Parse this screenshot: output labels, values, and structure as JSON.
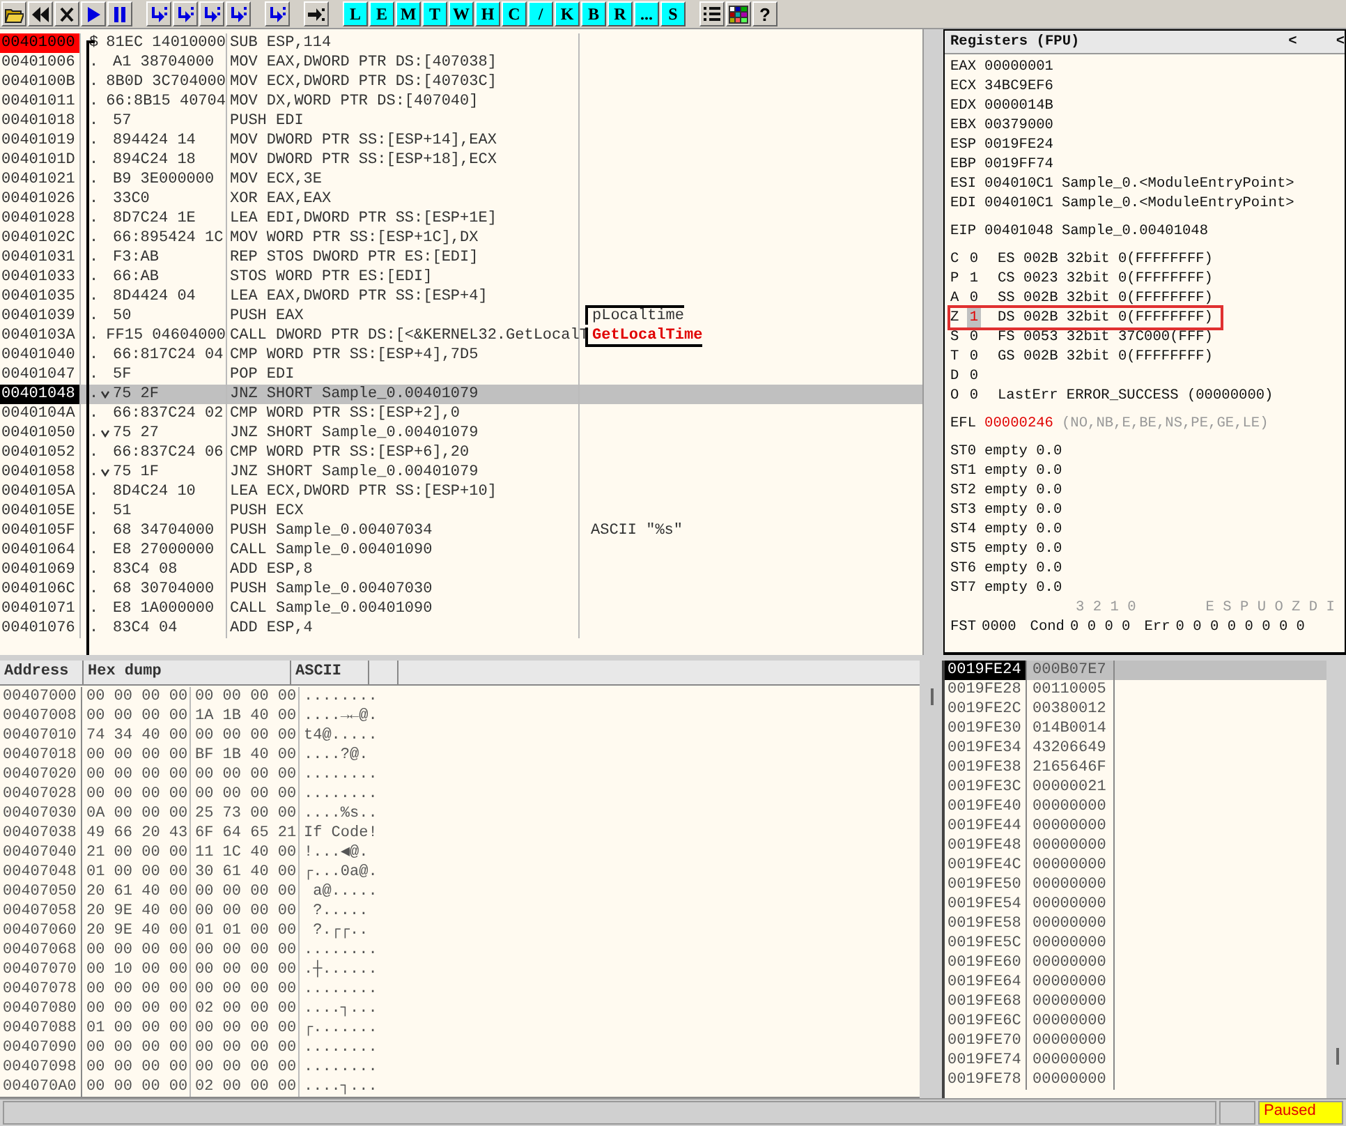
{
  "toolbar": {
    "tools": [
      {
        "kind": "open"
      },
      {
        "kind": "restart"
      },
      {
        "kind": "close"
      },
      {
        "kind": "run"
      },
      {
        "kind": "pause"
      },
      {
        "kind": "step-into"
      },
      {
        "kind": "step-over"
      },
      {
        "kind": "trace-into"
      },
      {
        "kind": "trace-over"
      },
      {
        "kind": "execute-till-return"
      },
      {
        "kind": "go-to"
      }
    ],
    "letters": [
      "L",
      "E",
      "M",
      "T",
      "W",
      "H",
      "C",
      "/",
      "K",
      "B",
      "R",
      "...",
      "S"
    ],
    "extras": [
      {
        "kind": "list"
      },
      {
        "kind": "palette"
      },
      {
        "kind": "help",
        "label": "?"
      }
    ]
  },
  "disassembly": {
    "rows": [
      {
        "address": "00401000",
        "mark": "$",
        "jump": false,
        "hex": "81EC 14010000",
        "instruction": "SUB ESP,114",
        "entry": true,
        "selected": false
      },
      {
        "address": "00401006",
        "mark": ".",
        "jump": false,
        "hex": "A1 38704000",
        "instruction": "MOV EAX,DWORD PTR DS:[407038]",
        "entry": false,
        "selected": false
      },
      {
        "address": "0040100B",
        "mark": ".",
        "jump": false,
        "hex": "8B0D 3C704000",
        "instruction": "MOV ECX,DWORD PTR DS:[40703C]",
        "entry": false,
        "selected": false
      },
      {
        "address": "00401011",
        "mark": ".",
        "jump": false,
        "hex": "66:8B15 40704",
        "instruction": "MOV DX,WORD PTR DS:[407040]",
        "entry": false,
        "selected": false
      },
      {
        "address": "00401018",
        "mark": ".",
        "jump": false,
        "hex": "57",
        "instruction": "PUSH EDI",
        "entry": false,
        "selected": false
      },
      {
        "address": "00401019",
        "mark": ".",
        "jump": false,
        "hex": "894424 14",
        "instruction": "MOV DWORD PTR SS:[ESP+14],EAX",
        "entry": false,
        "selected": false
      },
      {
        "address": "0040101D",
        "mark": ".",
        "jump": false,
        "hex": "894C24 18",
        "instruction": "MOV DWORD PTR SS:[ESP+18],ECX",
        "entry": false,
        "selected": false
      },
      {
        "address": "00401021",
        "mark": ".",
        "jump": false,
        "hex": "B9 3E000000",
        "instruction": "MOV ECX,3E",
        "entry": false,
        "selected": false
      },
      {
        "address": "00401026",
        "mark": ".",
        "jump": false,
        "hex": "33C0",
        "instruction": "XOR EAX,EAX",
        "entry": false,
        "selected": false
      },
      {
        "address": "00401028",
        "mark": ".",
        "jump": false,
        "hex": "8D7C24 1E",
        "instruction": "LEA EDI,DWORD PTR SS:[ESP+1E]",
        "entry": false,
        "selected": false
      },
      {
        "address": "0040102C",
        "mark": ".",
        "jump": false,
        "hex": "66:895424 1C",
        "instruction": "MOV WORD PTR SS:[ESP+1C],DX",
        "entry": false,
        "selected": false
      },
      {
        "address": "00401031",
        "mark": ".",
        "jump": false,
        "hex": "F3:AB",
        "instruction": "REP STOS DWORD PTR ES:[EDI]",
        "entry": false,
        "selected": false
      },
      {
        "address": "00401033",
        "mark": ".",
        "jump": false,
        "hex": "66:AB",
        "instruction": "STOS WORD PTR ES:[EDI]",
        "entry": false,
        "selected": false
      },
      {
        "address": "00401035",
        "mark": ".",
        "jump": false,
        "hex": "8D4424 04",
        "instruction": "LEA EAX,DWORD PTR SS:[ESP+4]",
        "entry": false,
        "selected": false
      },
      {
        "address": "00401039",
        "mark": ".",
        "jump": false,
        "hex": "50",
        "instruction": "PUSH EAX",
        "entry": false,
        "selected": false,
        "comment": {
          "text": "pLocaltime",
          "kind": "arg"
        }
      },
      {
        "address": "0040103A",
        "mark": ".",
        "jump": false,
        "hex": "FF15 04604000",
        "instruction": "CALL DWORD PTR DS:[<&KERNEL32.GetLocalT",
        "entry": false,
        "selected": false,
        "comment": {
          "text": "GetLocalTime",
          "kind": "call"
        }
      },
      {
        "address": "00401040",
        "mark": ".",
        "jump": false,
        "hex": "66:817C24 04",
        "instruction": "CMP WORD PTR SS:[ESP+4],7D5",
        "entry": false,
        "selected": false
      },
      {
        "address": "00401047",
        "mark": ".",
        "jump": false,
        "hex": "5F",
        "instruction": "POP EDI",
        "entry": false,
        "selected": false
      },
      {
        "address": "00401048",
        "mark": ".",
        "jump": true,
        "hex": "75 2F",
        "instruction": "JNZ SHORT Sample_0.00401079",
        "entry": false,
        "selected": true
      },
      {
        "address": "0040104A",
        "mark": ".",
        "jump": false,
        "hex": "66:837C24 02",
        "instruction": "CMP WORD PTR SS:[ESP+2],0",
        "entry": false,
        "selected": false
      },
      {
        "address": "00401050",
        "mark": ".",
        "jump": true,
        "hex": "75 27",
        "instruction": "JNZ SHORT Sample_0.00401079",
        "entry": false,
        "selected": false
      },
      {
        "address": "00401052",
        "mark": ".",
        "jump": false,
        "hex": "66:837C24 06",
        "instruction": "CMP WORD PTR SS:[ESP+6],20",
        "entry": false,
        "selected": false
      },
      {
        "address": "00401058",
        "mark": ".",
        "jump": true,
        "hex": "75 1F",
        "instruction": "JNZ SHORT Sample_0.00401079",
        "entry": false,
        "selected": false
      },
      {
        "address": "0040105A",
        "mark": ".",
        "jump": false,
        "hex": "8D4C24 10",
        "instruction": "LEA ECX,DWORD PTR SS:[ESP+10]",
        "entry": false,
        "selected": false
      },
      {
        "address": "0040105E",
        "mark": ".",
        "jump": false,
        "hex": "51",
        "instruction": "PUSH ECX",
        "entry": false,
        "selected": false
      },
      {
        "address": "0040105F",
        "mark": ".",
        "jump": false,
        "hex": "68 34704000",
        "instruction": "PUSH Sample_0.00407034",
        "entry": false,
        "selected": false,
        "comment": {
          "text": "ASCII \"%s\"",
          "kind": "plain"
        }
      },
      {
        "address": "00401064",
        "mark": ".",
        "jump": false,
        "hex": "E8 27000000",
        "instruction": "CALL Sample_0.00401090",
        "entry": false,
        "selected": false
      },
      {
        "address": "00401069",
        "mark": ".",
        "jump": false,
        "hex": "83C4 08",
        "instruction": "ADD ESP,8",
        "entry": false,
        "selected": false
      },
      {
        "address": "0040106C",
        "mark": ".",
        "jump": false,
        "hex": "68 30704000",
        "instruction": "PUSH Sample_0.00407030",
        "entry": false,
        "selected": false
      },
      {
        "address": "00401071",
        "mark": ".",
        "jump": false,
        "hex": "E8 1A000000",
        "instruction": "CALL Sample_0.00401090",
        "entry": false,
        "selected": false
      },
      {
        "address": "00401076",
        "mark": ".",
        "jump": false,
        "hex": "83C4 04",
        "instruction": "ADD ESP,4",
        "entry": false,
        "selected": false
      }
    ]
  },
  "registers": {
    "title": "Registers (FPU)",
    "arrows": [
      "<",
      "<"
    ],
    "general": [
      {
        "name": "EAX",
        "value": "00000001"
      },
      {
        "name": "ECX",
        "value": "34BC9EF6"
      },
      {
        "name": "EDX",
        "value": "0000014B"
      },
      {
        "name": "EBX",
        "value": "00379000"
      },
      {
        "name": "ESP",
        "value": "0019FE24"
      },
      {
        "name": "EBP",
        "value": "0019FF74"
      },
      {
        "name": "ESI",
        "value": "004010C1",
        "note": "Sample_0.<ModuleEntryPoint>"
      },
      {
        "name": "EDI",
        "value": "004010C1",
        "note": "Sample_0.<ModuleEntryPoint>"
      }
    ],
    "eip": {
      "name": "EIP",
      "value": "00401048",
      "note": "Sample_0.00401048"
    },
    "flags": [
      {
        "name": "C",
        "bit": "0",
        "changed": false,
        "boxed": false,
        "segment": "ES 002B 32bit 0(FFFFFFFF)"
      },
      {
        "name": "P",
        "bit": "1",
        "changed": false,
        "boxed": false,
        "segment": "CS 0023 32bit 0(FFFFFFFF)"
      },
      {
        "name": "A",
        "bit": "0",
        "changed": false,
        "boxed": false,
        "segment": "SS 002B 32bit 0(FFFFFFFF)"
      },
      {
        "name": "Z",
        "bit": "1",
        "changed": true,
        "boxed": true,
        "segment": "DS 002B 32bit 0(FFFFFFFF)"
      },
      {
        "name": "S",
        "bit": "0",
        "changed": false,
        "boxed": false,
        "segment": "FS 0053 32bit 37C000(FFF)"
      },
      {
        "name": "T",
        "bit": "0",
        "changed": false,
        "boxed": false,
        "segment": "GS 002B 32bit 0(FFFFFFFF)"
      },
      {
        "name": "D",
        "bit": "0",
        "changed": false,
        "boxed": false
      },
      {
        "name": "O",
        "bit": "0",
        "changed": false,
        "boxed": false,
        "segment": "LastErr ERROR_SUCCESS (00000000)"
      }
    ],
    "efl": {
      "name": "EFL",
      "value": "00000246",
      "changed": true,
      "note": "(NO,NB,E,BE,NS,PE,GE,LE)"
    },
    "fpu": [
      {
        "name": "ST0",
        "text": "empty 0.0"
      },
      {
        "name": "ST1",
        "text": "empty 0.0"
      },
      {
        "name": "ST2",
        "text": "empty 0.0"
      },
      {
        "name": "ST3",
        "text": "empty 0.0"
      },
      {
        "name": "ST4",
        "text": "empty 0.0"
      },
      {
        "name": "ST5",
        "text": "empty 0.0"
      },
      {
        "name": "ST6",
        "text": "empty 0.0"
      },
      {
        "name": "ST7",
        "text": "empty 0.0"
      }
    ],
    "fpu_bits": {
      "cond_bits": "3 2 1 0",
      "err_bits": "E S P U O Z D I"
    },
    "fst": {
      "name": "FST",
      "value": "0000",
      "cond_label": "Cond",
      "cond": "0 0 0 0",
      "err_label": "Err",
      "err": "0 0 0 0 0 0 0 0"
    }
  },
  "dump": {
    "columns": [
      "Address",
      "Hex dump",
      "ASCII"
    ],
    "rows": [
      {
        "address": "00407000",
        "hex": [
          "00 00 00 00",
          "00 00 00 00"
        ],
        "ascii": "........"
      },
      {
        "address": "00407008",
        "hex": [
          "00 00 00 00",
          "1A 1B 40 00"
        ],
        "ascii": "....→←@."
      },
      {
        "address": "00407010",
        "hex": [
          "74 34 40 00",
          "00 00 00 00"
        ],
        "ascii": "t4@....."
      },
      {
        "address": "00407018",
        "hex": [
          "00 00 00 00",
          "BF 1B 40 00"
        ],
        "ascii": "....?@."
      },
      {
        "address": "00407020",
        "hex": [
          "00 00 00 00",
          "00 00 00 00"
        ],
        "ascii": "........"
      },
      {
        "address": "00407028",
        "hex": [
          "00 00 00 00",
          "00 00 00 00"
        ],
        "ascii": "........"
      },
      {
        "address": "00407030",
        "hex": [
          "0A 00 00 00",
          "25 73 00 00"
        ],
        "ascii": "....%s.."
      },
      {
        "address": "00407038",
        "hex": [
          "49 66 20 43",
          "6F 64 65 21"
        ],
        "ascii": "If Code!"
      },
      {
        "address": "00407040",
        "hex": [
          "21 00 00 00",
          "11 1C 40 00"
        ],
        "ascii": "!...◀@."
      },
      {
        "address": "00407048",
        "hex": [
          "01 00 00 00",
          "30 61 40 00"
        ],
        "ascii": "┌...0a@."
      },
      {
        "address": "00407050",
        "hex": [
          "20 61 40 00",
          "00 00 00 00"
        ],
        "ascii": " a@....."
      },
      {
        "address": "00407058",
        "hex": [
          "20 9E 40 00",
          "00 00 00 00"
        ],
        "ascii": " ?....."
      },
      {
        "address": "00407060",
        "hex": [
          "20 9E 40 00",
          "01 01 00 00"
        ],
        "ascii": " ?.┌┌.."
      },
      {
        "address": "00407068",
        "hex": [
          "00 00 00 00",
          "00 00 00 00"
        ],
        "ascii": "........"
      },
      {
        "address": "00407070",
        "hex": [
          "00 10 00 00",
          "00 00 00 00"
        ],
        "ascii": ".┼......"
      },
      {
        "address": "00407078",
        "hex": [
          "00 00 00 00",
          "00 00 00 00"
        ],
        "ascii": "........"
      },
      {
        "address": "00407080",
        "hex": [
          "00 00 00 00",
          "02 00 00 00"
        ],
        "ascii": "....┐..."
      },
      {
        "address": "00407088",
        "hex": [
          "01 00 00 00",
          "00 00 00 00"
        ],
        "ascii": "┌......."
      },
      {
        "address": "00407090",
        "hex": [
          "00 00 00 00",
          "00 00 00 00"
        ],
        "ascii": "........"
      },
      {
        "address": "00407098",
        "hex": [
          "00 00 00 00",
          "00 00 00 00"
        ],
        "ascii": "........"
      },
      {
        "address": "004070A0",
        "hex": [
          "00 00 00 00",
          "02 00 00 00"
        ],
        "ascii": "....┐..."
      }
    ]
  },
  "stack": {
    "rows": [
      {
        "address": "0019FE24",
        "value": "000B07E7",
        "selected": true
      },
      {
        "address": "0019FE28",
        "value": "00110005",
        "selected": false
      },
      {
        "address": "0019FE2C",
        "value": "00380012",
        "selected": false
      },
      {
        "address": "0019FE30",
        "value": "014B0014",
        "selected": false
      },
      {
        "address": "0019FE34",
        "value": "43206649",
        "selected": false
      },
      {
        "address": "0019FE38",
        "value": "2165646F",
        "selected": false
      },
      {
        "address": "0019FE3C",
        "value": "00000021",
        "selected": false
      },
      {
        "address": "0019FE40",
        "value": "00000000",
        "selected": false
      },
      {
        "address": "0019FE44",
        "value": "00000000",
        "selected": false
      },
      {
        "address": "0019FE48",
        "value": "00000000",
        "selected": false
      },
      {
        "address": "0019FE4C",
        "value": "00000000",
        "selected": false
      },
      {
        "address": "0019FE50",
        "value": "00000000",
        "selected": false
      },
      {
        "address": "0019FE54",
        "value": "00000000",
        "selected": false
      },
      {
        "address": "0019FE58",
        "value": "00000000",
        "selected": false
      },
      {
        "address": "0019FE5C",
        "value": "00000000",
        "selected": false
      },
      {
        "address": "0019FE60",
        "value": "00000000",
        "selected": false
      },
      {
        "address": "0019FE64",
        "value": "00000000",
        "selected": false
      },
      {
        "address": "0019FE68",
        "value": "00000000",
        "selected": false
      },
      {
        "address": "0019FE6C",
        "value": "00000000",
        "selected": false
      },
      {
        "address": "0019FE70",
        "value": "00000000",
        "selected": false
      },
      {
        "address": "0019FE74",
        "value": "00000000",
        "selected": false
      },
      {
        "address": "0019FE78",
        "value": "00000000",
        "selected": false
      }
    ]
  },
  "status_bar": {
    "state": "Paused"
  }
}
